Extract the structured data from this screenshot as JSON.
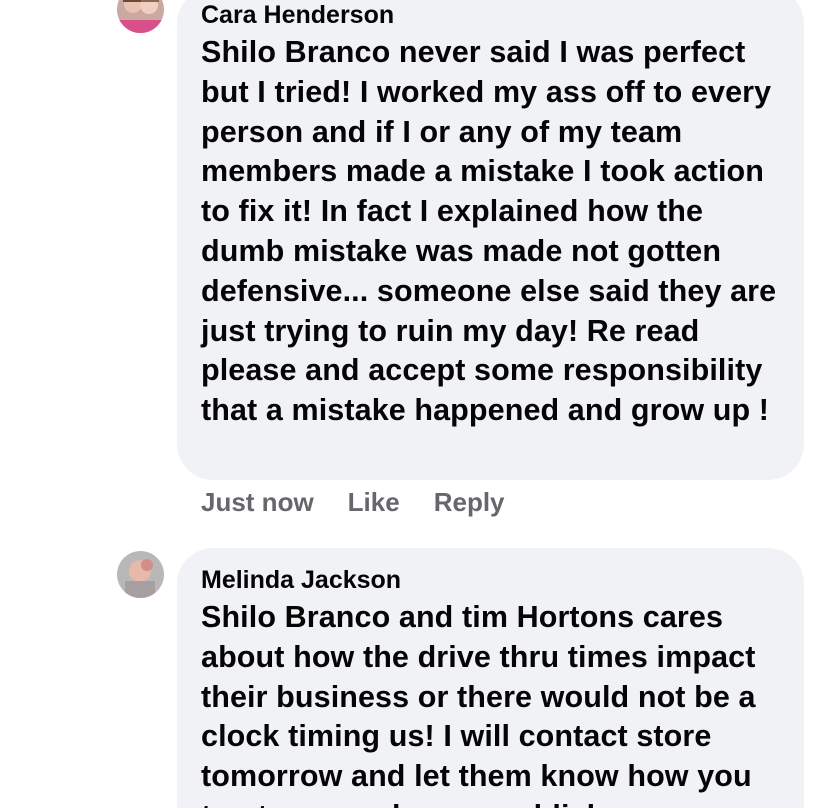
{
  "comments": [
    {
      "author": "Cara Henderson",
      "mention": "Shilo Branco",
      "text": " never said I was perfect but I tried!  I worked my ass off to every person and if I or any of my team members made a mistake I took action to fix it! In fact I explained how the dumb mistake was made not gotten defensive... someone else said they are just trying to ruin my day!  Re read please and accept some responsibility that a mistake happened and grow up !",
      "timestamp": "Just now",
      "like_label": "Like",
      "reply_label": "Reply"
    },
    {
      "author": "Melinda Jackson",
      "mention": "Shilo Branco",
      "text": " and tim Hortons cares about how the drive thru times impact their business or there would not be a clock timing us!  I will contact store tomorrow and let them know how you treat my employees publicly",
      "timestamp": "",
      "like_label": "",
      "reply_label": ""
    }
  ],
  "colors": {
    "bubble": "#f0f2f5",
    "text": "#050505",
    "secondary": "#65676b"
  }
}
